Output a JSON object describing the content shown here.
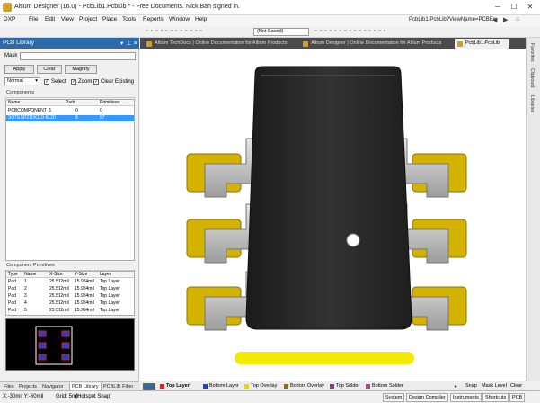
{
  "window": {
    "title": "Altium Designer (16.0) - PcbLib1.PcbLib * - Free Documents. Nick Ban signed in.",
    "controls": [
      "─",
      "☐",
      "✕"
    ]
  },
  "menu": {
    "items": [
      "DXP",
      "File",
      "Edit",
      "View",
      "Project",
      "Place",
      "Tools",
      "Reports",
      "Window",
      "Help"
    ],
    "path": "PcbLib1.PcbLib?ViewName=PCBEc"
  },
  "toolbar": {
    "unsaved": "(Not Saved)"
  },
  "panel": {
    "title": "PCB Library",
    "mask_label": "Mask",
    "mask_value": "",
    "apply": "Apply",
    "clear": "Clear",
    "magnify": "Magnify",
    "mode": "Normal",
    "select": "Select",
    "zoom": "Zoom",
    "clear_existing": "Clear Existing",
    "components_title": "Components",
    "components_headers": [
      "Name",
      "Pads",
      "Primitives"
    ],
    "components": [
      {
        "name": "PCBCOMPONENT_1",
        "pads": "0",
        "primitives": "0"
      },
      {
        "name": "SOTESP210X110-6L20",
        "pads": "6",
        "primitives": "57"
      }
    ],
    "primitives_title": "Component Primitives",
    "primitives_headers": [
      "Type",
      "Name",
      "X-Size",
      "Y-Size",
      "Layer"
    ],
    "primitives": [
      {
        "type": "Pad",
        "name": "1",
        "x": "25.512mil",
        "y": "15.984mil",
        "layer": "Top Layer"
      },
      {
        "type": "Pad",
        "name": "2",
        "x": "25.512mil",
        "y": "15.984mil",
        "layer": "Top Layer"
      },
      {
        "type": "Pad",
        "name": "3",
        "x": "25.512mil",
        "y": "15.984mil",
        "layer": "Top Layer"
      },
      {
        "type": "Pad",
        "name": "4",
        "x": "25.512mil",
        "y": "15.984mil",
        "layer": "Top Layer"
      },
      {
        "type": "Pad",
        "name": "5",
        "x": "25.512mil",
        "y": "15.984mil",
        "layer": "Top Layer"
      }
    ],
    "bottom_tabs": [
      "Files",
      "Projects",
      "Navigator",
      "PCB Library",
      "PCBLIB Filter"
    ],
    "active_tab": "PCB Library"
  },
  "doc_tabs": [
    {
      "label": "Altium TechDocs | Online Documentation for Altium Products",
      "active": false
    },
    {
      "label": "Altium Designer | Online Documentation for Altium Products",
      "active": false
    },
    {
      "label": "PcbLib1.PcbLib",
      "active": true
    }
  ],
  "right_panels": [
    "Favorites",
    "Clipboard",
    "Libraries"
  ],
  "layers": [
    {
      "name": "Top Layer",
      "color": "#d92020",
      "active": true
    },
    {
      "name": "Bottom Layer",
      "color": "#1f3fcc",
      "active": false
    },
    {
      "name": "Top Overlay",
      "color": "#e6d31a",
      "active": false
    },
    {
      "name": "Bottom Overlay",
      "color": "#8a6b1a",
      "active": false
    },
    {
      "name": "Top Solder",
      "color": "#8a3a8a",
      "active": false
    },
    {
      "name": "Bottom Solder",
      "color": "#b04090",
      "active": false
    }
  ],
  "layer_tools": [
    "Snap",
    "Mask Level",
    "Clear"
  ],
  "status": {
    "coords": "X:-30mil Y:-60mil",
    "grid": "Grid: 5mil",
    "snap": "(Hotspot Snap)",
    "buttons": [
      "System",
      "Design Compiler",
      "Instruments",
      "Shortcuts",
      "PCB"
    ]
  },
  "colors": {
    "pad_gold": "#d4b200",
    "body": "#2a2a2a",
    "lead": "#c8c8c8",
    "silk": "#f2ea00"
  }
}
